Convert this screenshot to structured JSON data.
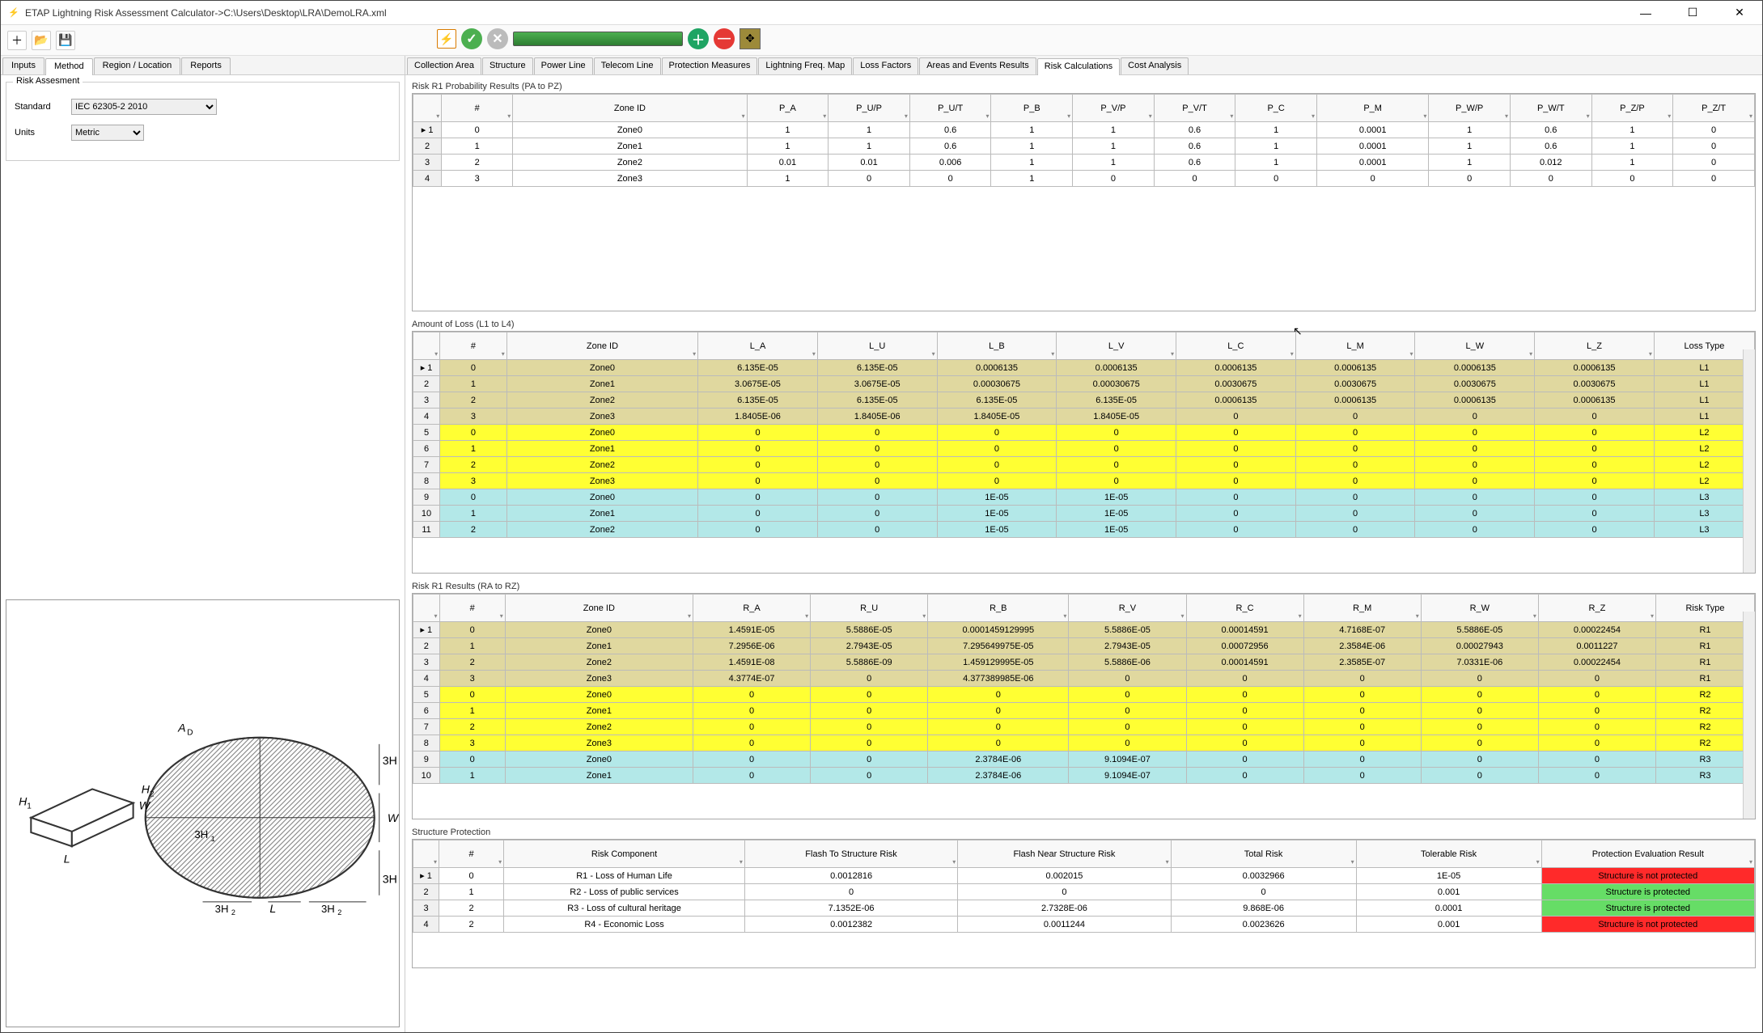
{
  "title": "ETAP Lightning Risk Assessment Calculator->C:\\Users\\Desktop\\LRA\\DemoLRA.xml",
  "leftTabs": [
    "Inputs",
    "Method",
    "Region / Location",
    "Reports"
  ],
  "activeLeftTab": 1,
  "groupLabel": "Risk Assesment",
  "form": {
    "standardLabel": "Standard",
    "standardValue": "IEC 62305-2 2010",
    "unitsLabel": "Units",
    "unitsValue": "Metric"
  },
  "rightTabs": [
    "Collection Area",
    "Structure",
    "Power Line",
    "Telecom Line",
    "Protection Measures",
    "Lightning Freq. Map",
    "Loss Factors",
    "Areas and Events Results",
    "Risk Calculations",
    "Cost Analysis"
  ],
  "activeRightTab": 8,
  "grid1": {
    "title": "Risk R1 Probability Results (PA to PZ)",
    "cols": [
      "",
      "#",
      "Zone ID",
      "P_A",
      "P_U/P",
      "P_U/T",
      "P_B",
      "P_V/P",
      "P_V/T",
      "P_C",
      "P_M",
      "P_W/P",
      "P_W/T",
      "P_Z/P",
      "P_Z/T"
    ],
    "rows": [
      [
        "▸ 1",
        "0",
        "Zone0",
        "1",
        "1",
        "0.6",
        "1",
        "1",
        "0.6",
        "1",
        "0.0001",
        "1",
        "0.6",
        "1",
        "0"
      ],
      [
        "2",
        "1",
        "Zone1",
        "1",
        "1",
        "0.6",
        "1",
        "1",
        "0.6",
        "1",
        "0.0001",
        "1",
        "0.6",
        "1",
        "0"
      ],
      [
        "3",
        "2",
        "Zone2",
        "0.01",
        "0.01",
        "0.006",
        "1",
        "1",
        "0.6",
        "1",
        "0.0001",
        "1",
        "0.012",
        "1",
        "0"
      ],
      [
        "4",
        "3",
        "Zone3",
        "1",
        "0",
        "0",
        "1",
        "0",
        "0",
        "0",
        "0",
        "0",
        "0",
        "0",
        "0"
      ]
    ]
  },
  "grid2": {
    "title": "Amount of Loss (L1 to L4)",
    "cols": [
      "",
      "#",
      "Zone ID",
      "L_A",
      "L_U",
      "L_B",
      "L_V",
      "L_C",
      "L_M",
      "L_W",
      "L_Z",
      "Loss Type"
    ],
    "rows": [
      {
        "c": [
          "▸ 1",
          "0",
          "Zone0",
          "6.135E-05",
          "6.135E-05",
          "0.0006135",
          "0.0006135",
          "0.0006135",
          "0.0006135",
          "0.0006135",
          "0.0006135",
          "L1"
        ],
        "cls": "khaki"
      },
      {
        "c": [
          "2",
          "1",
          "Zone1",
          "3.0675E-05",
          "3.0675E-05",
          "0.00030675",
          "0.00030675",
          "0.0030675",
          "0.0030675",
          "0.0030675",
          "0.0030675",
          "L1"
        ],
        "cls": "khaki"
      },
      {
        "c": [
          "3",
          "2",
          "Zone2",
          "6.135E-05",
          "6.135E-05",
          "6.135E-05",
          "6.135E-05",
          "0.0006135",
          "0.0006135",
          "0.0006135",
          "0.0006135",
          "L1"
        ],
        "cls": "khaki"
      },
      {
        "c": [
          "4",
          "3",
          "Zone3",
          "1.8405E-06",
          "1.8405E-06",
          "1.8405E-05",
          "1.8405E-05",
          "0",
          "0",
          "0",
          "0",
          "L1"
        ],
        "cls": "khaki"
      },
      {
        "c": [
          "5",
          "0",
          "Zone0",
          "0",
          "0",
          "0",
          "0",
          "0",
          "0",
          "0",
          "0",
          "L2"
        ],
        "cls": "yellow"
      },
      {
        "c": [
          "6",
          "1",
          "Zone1",
          "0",
          "0",
          "0",
          "0",
          "0",
          "0",
          "0",
          "0",
          "L2"
        ],
        "cls": "yellow"
      },
      {
        "c": [
          "7",
          "2",
          "Zone2",
          "0",
          "0",
          "0",
          "0",
          "0",
          "0",
          "0",
          "0",
          "L2"
        ],
        "cls": "yellow"
      },
      {
        "c": [
          "8",
          "3",
          "Zone3",
          "0",
          "0",
          "0",
          "0",
          "0",
          "0",
          "0",
          "0",
          "L2"
        ],
        "cls": "yellow"
      },
      {
        "c": [
          "9",
          "0",
          "Zone0",
          "0",
          "0",
          "1E-05",
          "1E-05",
          "0",
          "0",
          "0",
          "0",
          "L3"
        ],
        "cls": "cyan"
      },
      {
        "c": [
          "10",
          "1",
          "Zone1",
          "0",
          "0",
          "1E-05",
          "1E-05",
          "0",
          "0",
          "0",
          "0",
          "L3"
        ],
        "cls": "cyan"
      },
      {
        "c": [
          "11",
          "2",
          "Zone2",
          "0",
          "0",
          "1E-05",
          "1E-05",
          "0",
          "0",
          "0",
          "0",
          "L3"
        ],
        "cls": "cyan"
      }
    ]
  },
  "grid3": {
    "title": "Risk R1 Results (RA to RZ)",
    "cols": [
      "",
      "#",
      "Zone ID",
      "R_A",
      "R_U",
      "R_B",
      "R_V",
      "R_C",
      "R_M",
      "R_W",
      "R_Z",
      "Risk Type"
    ],
    "rows": [
      {
        "c": [
          "▸ 1",
          "0",
          "Zone0",
          "1.4591E-05",
          "5.5886E-05",
          "0.0001459129995",
          "5.5886E-05",
          "0.00014591",
          "4.7168E-07",
          "5.5886E-05",
          "0.00022454",
          "R1"
        ],
        "cls": "khaki"
      },
      {
        "c": [
          "2",
          "1",
          "Zone1",
          "7.2956E-06",
          "2.7943E-05",
          "7.295649975E-05",
          "2.7943E-05",
          "0.00072956",
          "2.3584E-06",
          "0.00027943",
          "0.0011227",
          "R1"
        ],
        "cls": "khaki"
      },
      {
        "c": [
          "3",
          "2",
          "Zone2",
          "1.4591E-08",
          "5.5886E-09",
          "1.459129995E-05",
          "5.5886E-06",
          "0.00014591",
          "2.3585E-07",
          "7.0331E-06",
          "0.00022454",
          "R1"
        ],
        "cls": "khaki"
      },
      {
        "c": [
          "4",
          "3",
          "Zone3",
          "4.3774E-07",
          "0",
          "4.377389985E-06",
          "0",
          "0",
          "0",
          "0",
          "0",
          "R1"
        ],
        "cls": "khaki"
      },
      {
        "c": [
          "5",
          "0",
          "Zone0",
          "0",
          "0",
          "0",
          "0",
          "0",
          "0",
          "0",
          "0",
          "R2"
        ],
        "cls": "yellow"
      },
      {
        "c": [
          "6",
          "1",
          "Zone1",
          "0",
          "0",
          "0",
          "0",
          "0",
          "0",
          "0",
          "0",
          "R2"
        ],
        "cls": "yellow"
      },
      {
        "c": [
          "7",
          "2",
          "Zone2",
          "0",
          "0",
          "0",
          "0",
          "0",
          "0",
          "0",
          "0",
          "R2"
        ],
        "cls": "yellow"
      },
      {
        "c": [
          "8",
          "3",
          "Zone3",
          "0",
          "0",
          "0",
          "0",
          "0",
          "0",
          "0",
          "0",
          "R2"
        ],
        "cls": "yellow"
      },
      {
        "c": [
          "9",
          "0",
          "Zone0",
          "0",
          "0",
          "2.3784E-06",
          "9.1094E-07",
          "0",
          "0",
          "0",
          "0",
          "R3"
        ],
        "cls": "cyan"
      },
      {
        "c": [
          "10",
          "1",
          "Zone1",
          "0",
          "0",
          "2.3784E-06",
          "9.1094E-07",
          "0",
          "0",
          "0",
          "0",
          "R3"
        ],
        "cls": "cyan"
      }
    ]
  },
  "grid4": {
    "title": "Structure Protection",
    "cols": [
      "",
      "#",
      "Risk Component",
      "Flash To Structure Risk",
      "Flash Near Structure Risk",
      "Total Risk",
      "Tolerable Risk",
      "Protection Evaluation Result"
    ],
    "rows": [
      {
        "c": [
          "▸ 1",
          "0",
          "R1 - Loss of Human Life",
          "0.0012816",
          "0.002015",
          "0.0032966",
          "1E-05",
          "Structure is not protected"
        ],
        "rc": "red"
      },
      {
        "c": [
          "2",
          "1",
          "R2 - Loss of public services",
          "0",
          "0",
          "0",
          "0.001",
          "Structure is protected"
        ],
        "rc": "green-cell"
      },
      {
        "c": [
          "3",
          "2",
          "R3 - Loss of cultural heritage",
          "7.1352E-06",
          "2.7328E-06",
          "9.868E-06",
          "0.0001",
          "Structure is protected"
        ],
        "rc": "green-cell"
      },
      {
        "c": [
          "4",
          "2",
          "R4 - Economic Loss",
          "0.0012382",
          "0.0011244",
          "0.0023626",
          "0.001",
          "Structure is not protected"
        ],
        "rc": "red"
      }
    ]
  }
}
